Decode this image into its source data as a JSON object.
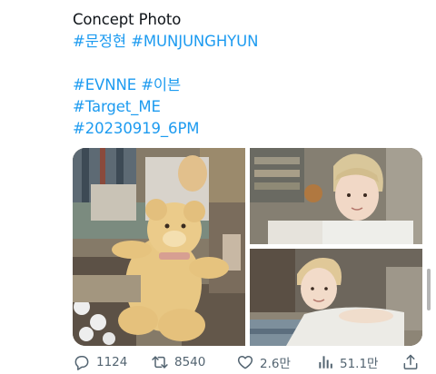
{
  "tweet": {
    "lines": [
      "Concept Photo",
      "#문정현 #MUNJUNGHYUN",
      "#EVNNE #이븐",
      "#Target_ME",
      "#20230919_6PM"
    ]
  },
  "media": {
    "photo_count": 3
  },
  "actions": {
    "replies": "1124",
    "retweets": "8540",
    "likes": "2.6만",
    "views": "51.1만"
  },
  "icons": {
    "reply": "reply-icon",
    "retweet": "retweet-icon",
    "like": "heart-icon",
    "views": "views-icon",
    "share": "share-icon"
  },
  "colors": {
    "link": "#1d9bf0",
    "text": "#0f1419",
    "muted": "#536471"
  }
}
